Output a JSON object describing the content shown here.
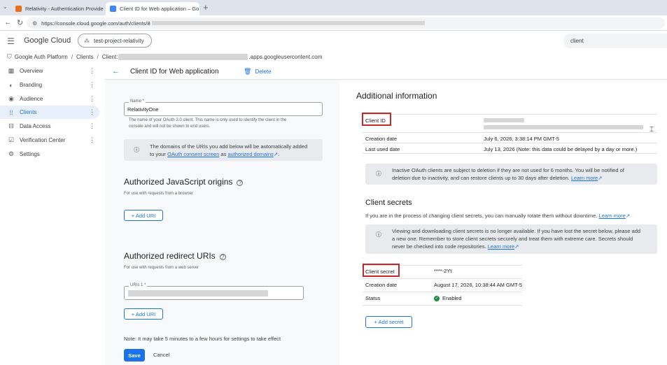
{
  "browser": {
    "tabs": [
      {
        "title": "Relativity - Authentication Provide",
        "favicon_color": "#e8711a"
      },
      {
        "title": "Client ID for Web application – Go",
        "favicon_color": "#4285f4"
      }
    ],
    "url": "https://console.cloud.google.com/auth/clients/8"
  },
  "header": {
    "logo": "Google Cloud",
    "project": "test-project-relativity",
    "search_value": "client"
  },
  "breadcrumb": {
    "root": "Google Auth Platform",
    "clients": "Clients",
    "client_prefix": "Client:",
    "client_suffix": ".apps.googleusercontent.com"
  },
  "sidebar": {
    "items": [
      {
        "label": "Overview",
        "icon": "dashboard-icon"
      },
      {
        "label": "Branding",
        "icon": "palette-icon"
      },
      {
        "label": "Audience",
        "icon": "person-icon"
      },
      {
        "label": "Clients",
        "icon": "grid-icon",
        "active": true
      },
      {
        "label": "Data Access",
        "icon": "data-access-icon"
      },
      {
        "label": "Verification Center",
        "icon": "checklist-icon"
      },
      {
        "label": "Settings",
        "icon": "gear-icon"
      }
    ]
  },
  "page": {
    "title": "Client ID for Web application",
    "delete_label": "Delete"
  },
  "form": {
    "name_label": "Name *",
    "name_value": "RelativityOne",
    "name_hint_1": "The name of your OAuth 2.0 client. This name is only used to identify the client in the",
    "name_hint_2": "console and will not be shown to end users.",
    "domains_info_1": "The domains of the URIs you add below will be automatically added",
    "domains_info_2": "to your",
    "domains_link_1": "OAuth consent screen",
    "domains_as": "as",
    "domains_link_2": "authorized domains",
    "domains_end": ".",
    "js_origins_title": "Authorized JavaScript origins",
    "js_origins_sub": "For use with requests from a browser",
    "add_uri_label": "+ Add URI",
    "redirect_title": "Authorized redirect URIs",
    "redirect_sub": "For use with requests from a web server",
    "uri_label": "URIs 1 *",
    "note": "Note: It may take 5 minutes to a few hours for settings to take effect",
    "save_label": "Save",
    "cancel_label": "Cancel"
  },
  "additional_info": {
    "title": "Additional information",
    "client_id_label": "Client ID",
    "creation_date_label": "Creation date",
    "creation_date_value": "July 6, 2026, 3:38:14 PM GMT-5",
    "last_used_label": "Last used date",
    "last_used_value": "July 13, 2026 (Note: this data could be delayed by a day or more.)",
    "inactive_info_1": "Inactive OAuth clients are subject to deletion if they are not used for 6 months. You will be notified of",
    "inactive_info_2": "deletion due to inactivity, and can restore clients up to 30 days after deletion.",
    "learn_more": "Learn more"
  },
  "client_secrets": {
    "title": "Client secrets",
    "sub": "If you are in the process of changing client secrets, you can manually rotate them without downtime.",
    "learn_more": "Learn more",
    "info_1": "Viewing and downloading client secrets is no longer available. If you have lost the secret below, please add",
    "info_2": "a new one. Remember to store client secrets securely and treat them with extreme care. Secrets should",
    "info_3": "never be checked into code repositories.",
    "secret_label": "Client secret",
    "secret_value": "****-2Yt",
    "creation_date_label": "Creation date",
    "creation_date_value": "August 17, 2026, 10:38:44 AM GMT-5",
    "status_label": "Status",
    "status_value": "Enabled",
    "add_secret_label": "+ Add secret"
  },
  "colors": {
    "accent": "#1a73e8",
    "highlight": "#c62828",
    "enabled": "#1e8e3e"
  }
}
